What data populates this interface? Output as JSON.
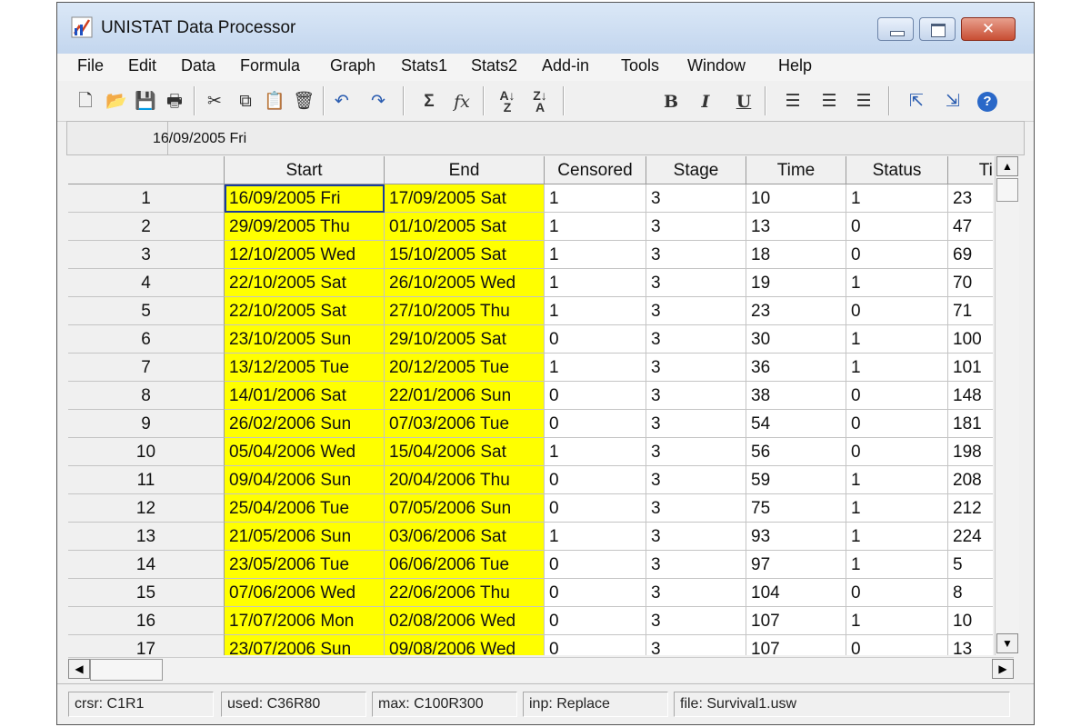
{
  "window": {
    "title": "UNISTAT Data Processor"
  },
  "menu": [
    "File",
    "Edit",
    "Data",
    "Formula",
    "Graph",
    "Stats1",
    "Stats2",
    "Add-in",
    "Tools",
    "Window",
    "Help"
  ],
  "toolbar": {
    "bold": "B",
    "italic": "I",
    "underline": "U",
    "sum": "Σ",
    "fx": "fx"
  },
  "cellbar": {
    "value": "16/09/2005 Fri"
  },
  "grid": {
    "columns": [
      "Start",
      "End",
      "Censored",
      "Stage",
      "Time",
      "Status",
      "Time"
    ],
    "rows": [
      [
        "1",
        "16/09/2005 Fri",
        "17/09/2005 Sat",
        "1",
        "3",
        "10",
        "1",
        "23"
      ],
      [
        "2",
        "29/09/2005 Thu",
        "01/10/2005 Sat",
        "1",
        "3",
        "13",
        "0",
        "47"
      ],
      [
        "3",
        "12/10/2005 Wed",
        "15/10/2005 Sat",
        "1",
        "3",
        "18",
        "0",
        "69"
      ],
      [
        "4",
        "22/10/2005 Sat",
        "26/10/2005 Wed",
        "1",
        "3",
        "19",
        "1",
        "70"
      ],
      [
        "5",
        "22/10/2005 Sat",
        "27/10/2005 Thu",
        "1",
        "3",
        "23",
        "0",
        "71"
      ],
      [
        "6",
        "23/10/2005 Sun",
        "29/10/2005 Sat",
        "0",
        "3",
        "30",
        "1",
        "100"
      ],
      [
        "7",
        "13/12/2005 Tue",
        "20/12/2005 Tue",
        "1",
        "3",
        "36",
        "1",
        "101"
      ],
      [
        "8",
        "14/01/2006 Sat",
        "22/01/2006 Sun",
        "0",
        "3",
        "38",
        "0",
        "148"
      ],
      [
        "9",
        "26/02/2006 Sun",
        "07/03/2006 Tue",
        "0",
        "3",
        "54",
        "0",
        "181"
      ],
      [
        "10",
        "05/04/2006 Wed",
        "15/04/2006 Sat",
        "1",
        "3",
        "56",
        "0",
        "198"
      ],
      [
        "11",
        "09/04/2006 Sun",
        "20/04/2006 Thu",
        "0",
        "3",
        "59",
        "1",
        "208"
      ],
      [
        "12",
        "25/04/2006 Tue",
        "07/05/2006 Sun",
        "0",
        "3",
        "75",
        "1",
        "212"
      ],
      [
        "13",
        "21/05/2006 Sun",
        "03/06/2006 Sat",
        "1",
        "3",
        "93",
        "1",
        "224"
      ],
      [
        "14",
        "23/05/2006 Tue",
        "06/06/2006 Tue",
        "0",
        "3",
        "97",
        "1",
        "5"
      ],
      [
        "15",
        "07/06/2006 Wed",
        "22/06/2006 Thu",
        "0",
        "3",
        "104",
        "0",
        "8"
      ],
      [
        "16",
        "17/07/2006 Mon",
        "02/08/2006 Wed",
        "0",
        "3",
        "107",
        "1",
        "10"
      ],
      [
        "17",
        "23/07/2006 Sun",
        "09/08/2006 Wed",
        "0",
        "3",
        "107",
        "0",
        "13"
      ]
    ]
  },
  "status": {
    "cursor": "crsr: C1R1",
    "used": "used: C36R80",
    "max": "max: C100R300",
    "input": "inp: Replace",
    "file": "file: Survival1.usw"
  },
  "colors": {
    "highlight": "#ffff00",
    "selection": "#1a3c9c"
  }
}
